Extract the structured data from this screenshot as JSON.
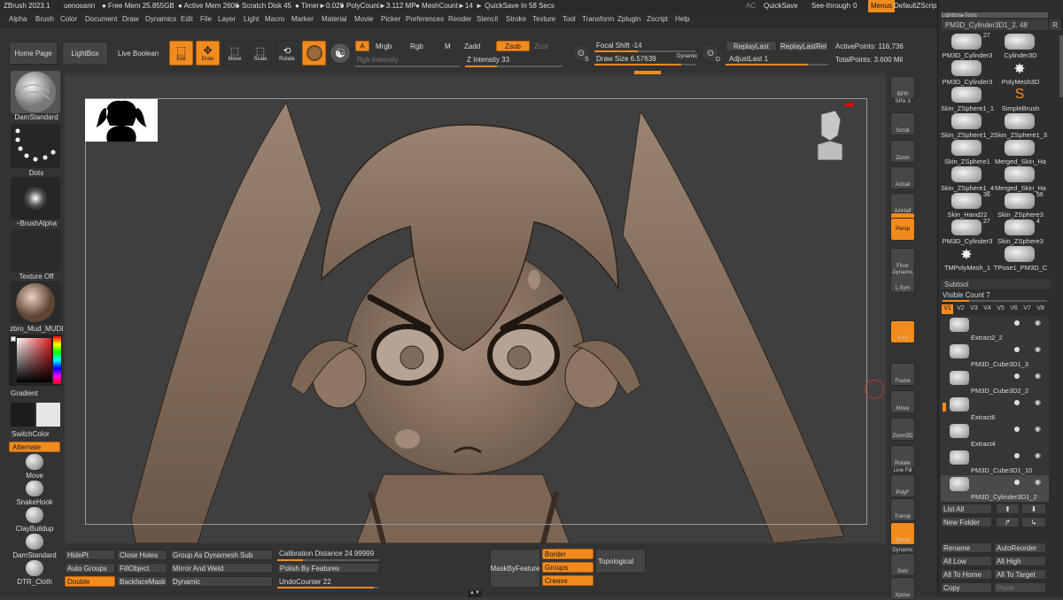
{
  "titlebar": {
    "app": "ZBrush 2023.1",
    "user": "uenosann",
    "free_mem": "● Free Mem 25.855GB",
    "active_mem": "● Active Mem 2606",
    "scratch": "● Scratch Disk 45",
    "timer": "● Timer►0.029",
    "polycount": "● PolyCount►3.112 MP",
    "meshcount": "● MeshCount►14",
    "quicksave_in": "► QuickSave In 58 Secs",
    "ac": "AC",
    "quicksave": "QuickSave",
    "seethrough": "See-through",
    "seethrough_val": "0",
    "menus": "Menus",
    "script": "DefaultZScript"
  },
  "menus": [
    "Alpha",
    "Brush",
    "Color",
    "Document",
    "Draw",
    "Dynamics",
    "Edit",
    "File",
    "Layer",
    "Light",
    "Macro",
    "Marker",
    "Material",
    "Movie",
    "Picker",
    "Preferences",
    "Render",
    "Stencil",
    "Stroke",
    "Texture",
    "Tool",
    "Transform",
    "Zplugin",
    "Zscript",
    "Help"
  ],
  "top": {
    "home": "Home Page",
    "lightbox": "LightBox",
    "liveboolean": "Live Boolean",
    "edit": "Edit",
    "draw": "Draw",
    "move": "Move",
    "scale": "Scale",
    "rotate": "Rotate",
    "a": "A",
    "mrgb": "Mrgb",
    "rgb": "Rgb",
    "m": "M",
    "zadd": "Zadd",
    "zsub": "Zsub",
    "zcut": "Zcut",
    "rgb_intensity": "Rgb Intensity",
    "z_intensity": "Z Intensity 33",
    "focal_shift": "Focal Shift -14",
    "draw_size": "Draw Size 6.57639",
    "dynamic": "Dynamic",
    "replaylast": "ReplayLast",
    "replaylastrel": "ReplayLastRel",
    "adjustlast": "AdjustLast 1",
    "active_points": "ActivePoints: 116,736",
    "total_points": "TotalPoints: 3.600 Mil",
    "s": "S",
    "d": "D",
    "z_intensity_frac": 0.33,
    "draw_size_frac": 0.86,
    "focal_shift_frac": 0.43
  },
  "left": {
    "damstandard": "DamStandard",
    "dots": "Dots",
    "brushalpha": "~BrushAlpha",
    "texture_off": "Texture Off",
    "material": "zbro_Mud_MUDE",
    "gradient": "Gradient",
    "switchcolor": "SwitchColor",
    "alternate": "Alternate",
    "brushes": [
      "Move",
      "SnakeHook",
      "ClayBuildup",
      "DamStandard",
      "DTR_Cloth"
    ]
  },
  "right": {
    "bpr": "BPR",
    "spix": "SPix 3",
    "scroll": "Scroll",
    "zoom": "Zoom",
    "actual": "Actual",
    "aahalf": "AAHalf",
    "dynamic": "Dynamic",
    "persp": "Persp",
    "floor": "Floor",
    "lsym": "L.Sym",
    "dynamic2": "Dynamic",
    "xyz": "XYZ",
    "frame": "Frame",
    "move": "Move",
    "zoom3d": "Zoom3D",
    "rotate": "Rotate",
    "linefill": "Line Fill",
    "polyf": "PolyF",
    "transp": "Transp",
    "ghost": "Ghost",
    "dynamic3": "Dynamic",
    "solo": "Solo",
    "xpose": "Xpose"
  },
  "bottom": {
    "hidept": "HidePt",
    "closeholes": "Close Holes",
    "groupdyn": "Group As Dynamesh Sub",
    "autogroups": "Auto Groups",
    "fillobject": "FillObject",
    "mirrorweld": "Mirror And Weld",
    "double": "Double",
    "backfacemask": "BackfaceMask",
    "dynamic": "Dynamic",
    "calib": "Calibration Distance 24.99999",
    "polish": "Polish By Features",
    "undo": "UndoCounter 22",
    "maskbyfeature": "MaskByFeature",
    "border": "Border",
    "groups": "Groups",
    "crease": "Crease",
    "topological": "Topological",
    "calib_frac": 0.25,
    "undo_frac": 0.95
  },
  "tray": {
    "lightbox_tools": "Lightbox▸Tools",
    "tool_name": "PM3D_Cylinder3D1_2. 48",
    "r": "R",
    "tools": [
      {
        "label": "PM3D_Cylinder3",
        "count": "27"
      },
      {
        "label": "Cylinder3D",
        "count": ""
      },
      {
        "label": "PM3D_Cylinder3",
        "count": ""
      },
      {
        "label": "PolyMesh3D",
        "count": ""
      },
      {
        "label": "Skin_ZSphere1_1",
        "count": ""
      },
      {
        "label": "SimpleBrush",
        "count": ""
      },
      {
        "label": "Skin_ZSphere1_2",
        "count": ""
      },
      {
        "label": "Skin_ZSphere1_3",
        "count": ""
      },
      {
        "label": "Skin_ZSphere1",
        "count": ""
      },
      {
        "label": "Merged_Skin_Ha",
        "count": ""
      },
      {
        "label": "Skin_ZSphere1_4",
        "count": ""
      },
      {
        "label": "Merged_Skin_Ha",
        "count": ""
      },
      {
        "label": "Skin_Hand22",
        "count": "36"
      },
      {
        "label": "Skin_ZSphere3",
        "count": "56"
      },
      {
        "label": "PM3D_Cylinder3",
        "count": "27"
      },
      {
        "label": "Skin_ZSphere3",
        "count": "4"
      },
      {
        "label": "TMPolyMesh_1",
        "count": ""
      },
      {
        "label": "TPose1_PM3D_C",
        "count": ""
      }
    ],
    "subtool": "Subtool",
    "visible_count": "Visible Count 7",
    "vs": [
      "V1",
      "V2",
      "V3",
      "V4",
      "V5",
      "V6",
      "V7",
      "V8"
    ],
    "subtools": [
      "Extract2_2",
      "PM3D_Cube3D1_3",
      "PM3D_Cube3D2_2",
      "Extract6",
      "Extract4",
      "PM3D_Cube3D1_10",
      "PM3D_Cylinder3D1_2"
    ],
    "listall": "List All",
    "newfolder": "New Folder",
    "rename": "Rename",
    "autoreorder": "AutoReorder",
    "alllow": "All Low",
    "allhigh": "All High",
    "alltohome": "All To Home",
    "alltotarget": "All To Target",
    "copy": "Copy",
    "paste": "Paste"
  },
  "colors": {
    "accent": "#f28b1e",
    "clay": "#8a7462",
    "bg": "#3f3f3f"
  }
}
